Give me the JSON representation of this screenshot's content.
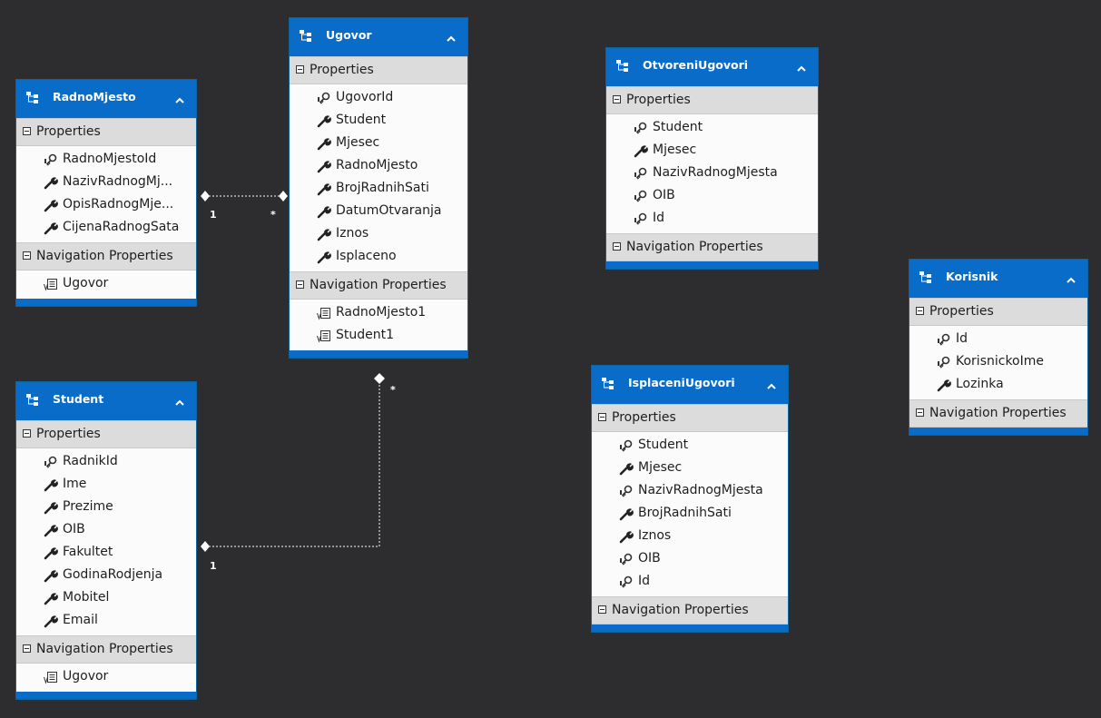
{
  "colors": {
    "header": "#0a6cc9",
    "background": "#2d2d30",
    "connector": "#ffffff"
  },
  "section_labels": {
    "properties": "Properties",
    "navigation": "Navigation Properties"
  },
  "entities": {
    "radnomjesto": {
      "title": "RadnoMjesto",
      "properties": [
        {
          "name": "RadnoMjestoId",
          "icon": "key-icon"
        },
        {
          "name": "NazivRadnogMj...",
          "icon": "wrench-icon"
        },
        {
          "name": "OpisRadnogMje...",
          "icon": "wrench-icon"
        },
        {
          "name": "CijenaRadnogSata",
          "icon": "wrench-icon"
        }
      ],
      "navigation": [
        {
          "name": "Ugovor",
          "icon": "navigation-property-icon"
        }
      ]
    },
    "ugovor": {
      "title": "Ugovor",
      "properties": [
        {
          "name": "UgovorId",
          "icon": "key-icon"
        },
        {
          "name": "Student",
          "icon": "wrench-icon"
        },
        {
          "name": "Mjesec",
          "icon": "wrench-icon"
        },
        {
          "name": "RadnoMjesto",
          "icon": "wrench-icon"
        },
        {
          "name": "BrojRadnihSati",
          "icon": "wrench-icon"
        },
        {
          "name": "DatumOtvaranja",
          "icon": "wrench-icon"
        },
        {
          "name": "Iznos",
          "icon": "wrench-icon"
        },
        {
          "name": "Isplaceno",
          "icon": "wrench-icon"
        }
      ],
      "navigation": [
        {
          "name": "RadnoMjesto1",
          "icon": "navigation-property-icon"
        },
        {
          "name": "Student1",
          "icon": "navigation-property-icon"
        }
      ]
    },
    "otvoreniugovori": {
      "title": "OtvoreniUgovori",
      "properties": [
        {
          "name": "Student",
          "icon": "key-icon"
        },
        {
          "name": "Mjesec",
          "icon": "wrench-icon"
        },
        {
          "name": "NazivRadnogMjesta",
          "icon": "key-icon"
        },
        {
          "name": "OIB",
          "icon": "key-icon"
        },
        {
          "name": "Id",
          "icon": "key-icon"
        }
      ],
      "navigation": []
    },
    "korisnik": {
      "title": "Korisnik",
      "properties": [
        {
          "name": "Id",
          "icon": "key-icon"
        },
        {
          "name": "KorisnickoIme",
          "icon": "key-icon"
        },
        {
          "name": "Lozinka",
          "icon": "wrench-icon"
        }
      ],
      "navigation": []
    },
    "student": {
      "title": "Student",
      "properties": [
        {
          "name": "RadnikId",
          "icon": "key-icon"
        },
        {
          "name": "Ime",
          "icon": "wrench-icon"
        },
        {
          "name": "Prezime",
          "icon": "wrench-icon"
        },
        {
          "name": "OIB",
          "icon": "wrench-icon"
        },
        {
          "name": "Fakultet",
          "icon": "wrench-icon"
        },
        {
          "name": "GodinaRodjenja",
          "icon": "wrench-icon"
        },
        {
          "name": "Mobitel",
          "icon": "wrench-icon"
        },
        {
          "name": "Email",
          "icon": "wrench-icon"
        }
      ],
      "navigation": [
        {
          "name": "Ugovor",
          "icon": "navigation-property-icon"
        }
      ]
    },
    "isplaceniugovori": {
      "title": "IsplaceniUgovori",
      "properties": [
        {
          "name": "Student",
          "icon": "key-icon"
        },
        {
          "name": "Mjesec",
          "icon": "wrench-icon"
        },
        {
          "name": "NazivRadnogMjesta",
          "icon": "key-icon"
        },
        {
          "name": "BrojRadnihSati",
          "icon": "wrench-icon"
        },
        {
          "name": "Iznos",
          "icon": "wrench-icon"
        },
        {
          "name": "OIB",
          "icon": "key-icon"
        },
        {
          "name": "Id",
          "icon": "key-icon"
        }
      ],
      "navigation": []
    }
  },
  "associations": [
    {
      "from": "RadnoMjesto",
      "to": "Ugovor",
      "from_multiplicity": "1",
      "to_multiplicity": "*"
    },
    {
      "from": "Student",
      "to": "Ugovor",
      "from_multiplicity": "1",
      "to_multiplicity": "*"
    }
  ]
}
